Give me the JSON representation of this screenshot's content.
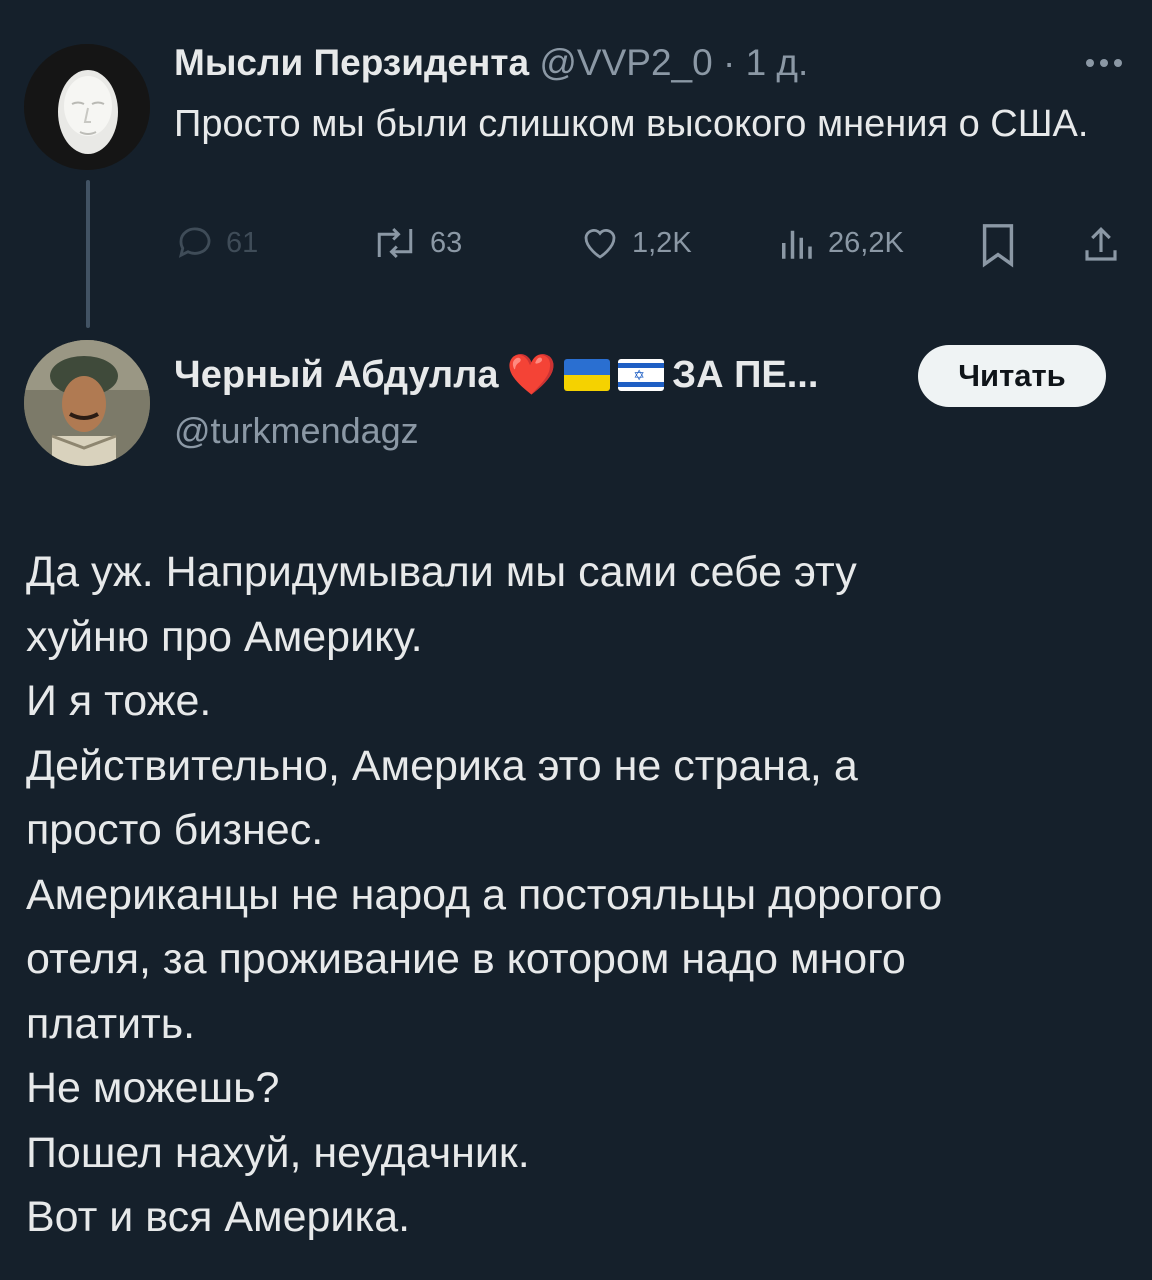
{
  "tweet1": {
    "author_name": "Мысли Перзидента",
    "handle": "@VVP2_0",
    "separator": "·",
    "time": "1 д.",
    "text": "Просто мы были слишком высокого мнения о США.",
    "stats": {
      "replies": "61",
      "retweets": "63",
      "likes": "1,2K",
      "views": "26,2K"
    }
  },
  "tweet2": {
    "author_name": "Черный Абдулла",
    "name_emoji": "❤️",
    "name_suffix": "ЗА ПЕ...",
    "handle": "@turkmendagz",
    "follow_label": "Читать",
    "lines": [
      "Да уж. Напридумывали мы сами себе  эту",
      "хуйню про Америку.",
      "И я тоже.",
      "Действительно, Америка это не страна, а",
      "просто бизнес.",
      "Американцы не народ а постояльцы дорогого",
      "отеля, за проживание в котором надо много",
      "платить.",
      "Не можешь?",
      "Пошел нахуй, неудачник.",
      "Вот и вся Америка."
    ]
  },
  "colors": {
    "background": "#15202b",
    "text": "#e7e9ea",
    "muted": "#8b98a5",
    "button_bg": "#eff3f4"
  },
  "icons": [
    "more-icon",
    "reply-icon",
    "retweet-icon",
    "like-icon",
    "views-icon",
    "bookmark-icon",
    "share-icon",
    "heart-emoji",
    "ukraine-flag",
    "israel-flag"
  ]
}
